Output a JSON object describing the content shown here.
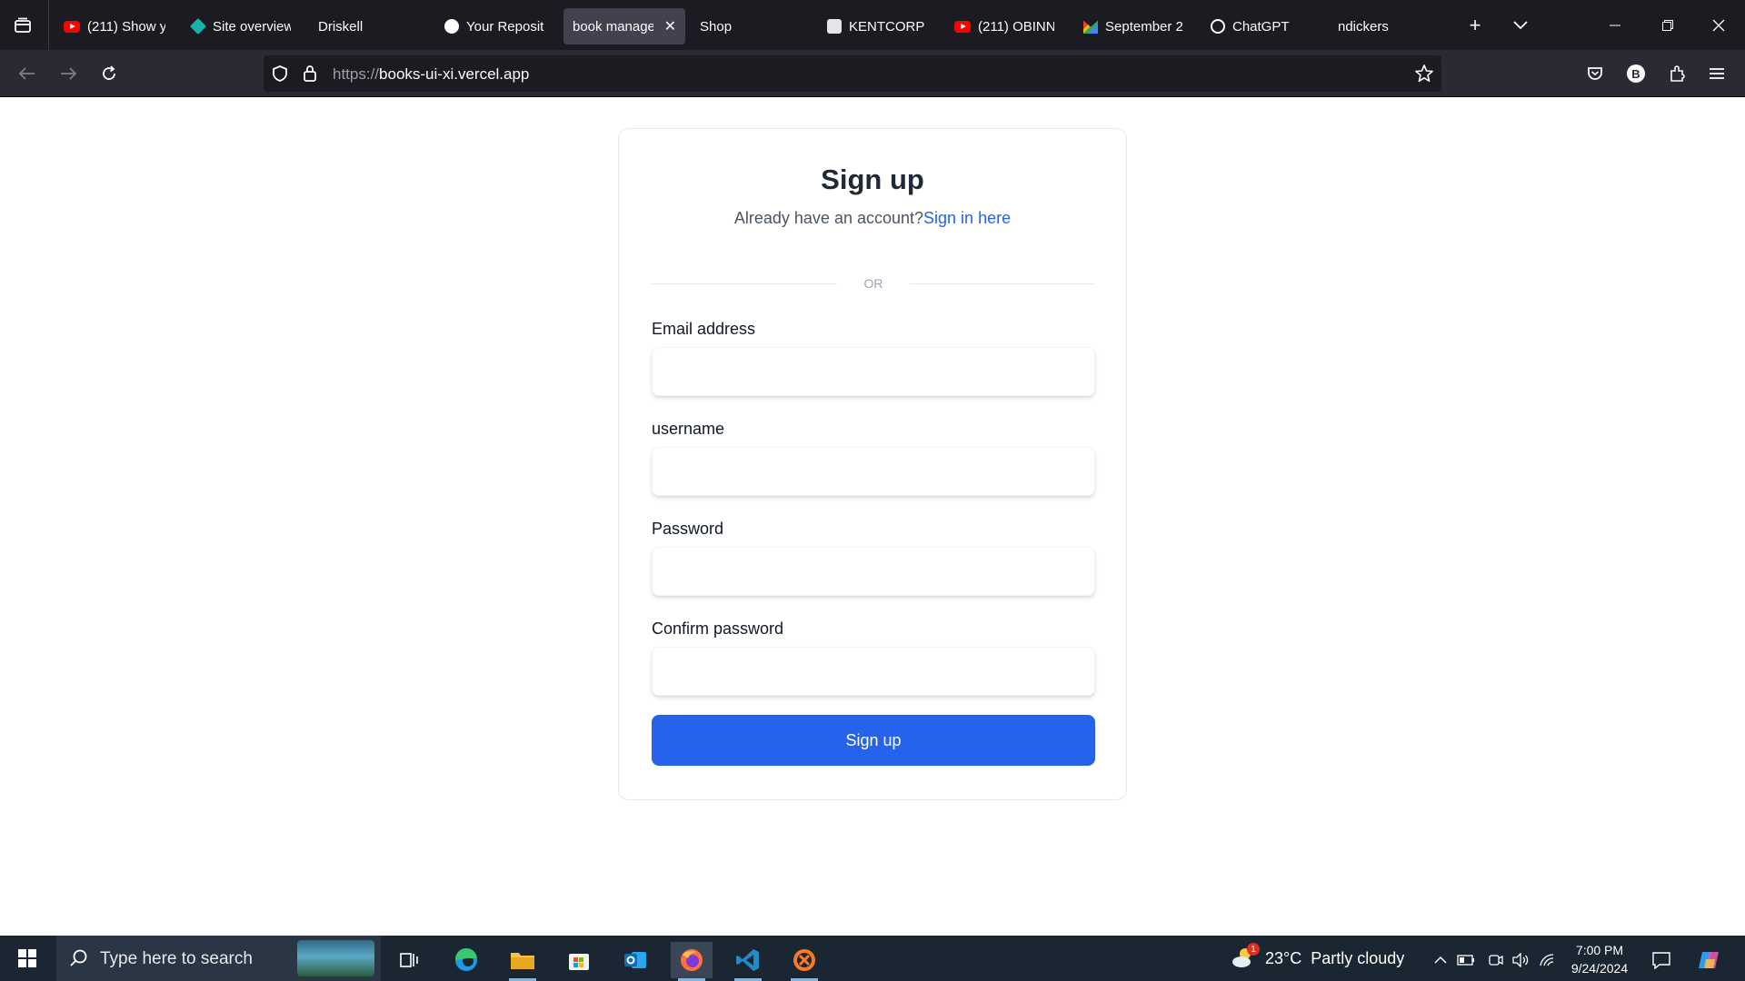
{
  "browser": {
    "tabs": [
      {
        "label": "(211) Show y",
        "icon": "youtube-icon",
        "active": false
      },
      {
        "label": "Site overview",
        "icon": "diamond-icon",
        "active": false
      },
      {
        "label": "Driskell",
        "icon": "",
        "active": false
      },
      {
        "label": "Your Reposito",
        "icon": "github-icon",
        "active": false
      },
      {
        "label": "book manager",
        "icon": "",
        "active": true
      },
      {
        "label": "Shop",
        "icon": "",
        "active": false
      },
      {
        "label": "KENTCORP FI",
        "icon": "kentcorp-icon",
        "active": false
      },
      {
        "label": "(211) OBINN",
        "icon": "youtube-icon",
        "active": false
      },
      {
        "label": "September 2",
        "icon": "gmail-icon",
        "active": false
      },
      {
        "label": "ChatGPT",
        "icon": "chatgpt-icon",
        "active": false
      },
      {
        "label": "ndickers",
        "icon": "",
        "active": false
      }
    ],
    "url_protocol": "https://",
    "url_host": "books-ui-xi.vercel.app",
    "profile_initial": "B"
  },
  "page": {
    "title": "Sign up",
    "subtitle_prefix": "Already have an account?",
    "signin_link": "Sign in here",
    "divider_text": "OR",
    "fields": [
      {
        "label": "Email address",
        "value": "",
        "placeholder": ""
      },
      {
        "label": "username",
        "value": "",
        "placeholder": ""
      },
      {
        "label": "Password",
        "value": "",
        "placeholder": ""
      },
      {
        "label": "Confirm password",
        "value": "",
        "placeholder": ""
      }
    ],
    "submit_label": "Sign up"
  },
  "taskbar": {
    "search_placeholder": "Type here to search",
    "weather": "23°C  Partly cloudy",
    "weather_badge": "1",
    "time": "7:00 PM",
    "date": "9/24/2024"
  },
  "colors": {
    "accent": "#2563eb",
    "tab_bar": "#1c1b22",
    "nav_bar": "#2b2a33",
    "taskbar": "#1b2633"
  }
}
